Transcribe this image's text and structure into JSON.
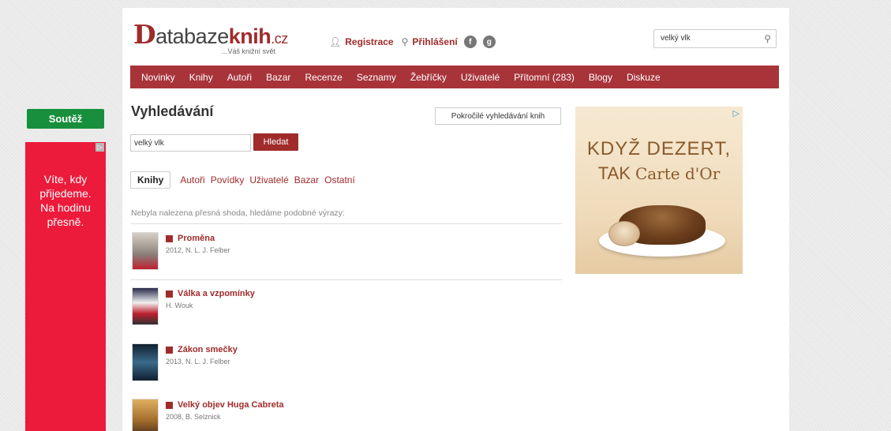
{
  "header": {
    "logo_d": "D",
    "logo_part1": "atabaze",
    "logo_part2": "knih",
    "logo_tld": ".cz",
    "logo_slogan": "...Váš knižní svět",
    "register_label": "Registrace",
    "login_label": "Přihlášení",
    "search_value": "velký vlk"
  },
  "menu": [
    {
      "label": "Novinky"
    },
    {
      "label": "Knihy"
    },
    {
      "label": "Autoři"
    },
    {
      "label": "Bazar"
    },
    {
      "label": "Recenze"
    },
    {
      "label": "Seznamy"
    },
    {
      "label": "Žebříčky"
    },
    {
      "label": "Uživatelé"
    },
    {
      "label": "Přítomní (283)"
    },
    {
      "label": "Blogy"
    },
    {
      "label": "Diskuze"
    }
  ],
  "page": {
    "title": "Vyhledávání",
    "advanced_button": "Pokročilé vyhledávání knih",
    "query_value": "velký vlk",
    "search_button": "Hledat",
    "tabs": [
      {
        "label": "Knihy",
        "active": true
      },
      {
        "label": "Autoři"
      },
      {
        "label": "Povídky"
      },
      {
        "label": "Uživatelé"
      },
      {
        "label": "Bazar"
      },
      {
        "label": "Ostatní"
      }
    ],
    "notice": "Nebyla nalezena přesná shoda, hledáme podobné výrazy:"
  },
  "results": [
    {
      "title": "Proměna",
      "sub": "2012, N. L. J. Felber",
      "cover_color": "#b8b0a8"
    },
    {
      "title": "Válka a vzpomínky",
      "sub": "H. Wouk",
      "cover_color": "#3a3a5a"
    },
    {
      "title": "Zákon smečky",
      "sub": "2013, N. L. J. Felber",
      "cover_color": "#2a4a6a"
    },
    {
      "title": "Velký objev Huga Cabreta",
      "sub": "2008, B. Selznick",
      "cover_color": "#c89a4a"
    }
  ],
  "ad_right": {
    "line1": "KDYŽ DEZERT,",
    "line2_a": "TAK ",
    "line2_b": "Carte d'Or"
  },
  "sidebar": {
    "contest_label": "Soutěž",
    "ad_text_1": "Víte, kdy",
    "ad_text_2": "přijedeme.",
    "ad_text_3": "Na hodinu",
    "ad_text_4": "přesně."
  },
  "colors": {
    "brand": "#a02b2b",
    "menu_bg": "#a8343a",
    "contest_green": "#178f3c",
    "ad_red": "#ec1b3b"
  }
}
